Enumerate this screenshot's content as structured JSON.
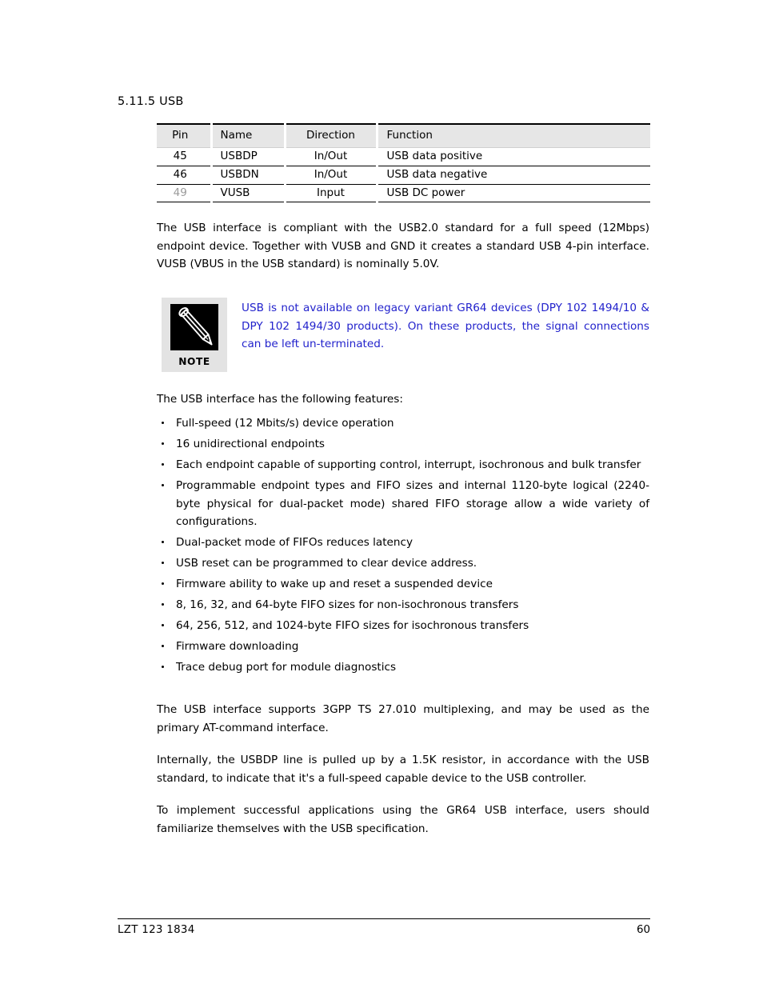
{
  "heading": "5.11.5 USB",
  "table": {
    "columns": [
      "Pin",
      "Name",
      "Direction",
      "Function"
    ],
    "rows": [
      {
        "pin": "45",
        "name": "USBDP",
        "direction": "In/Out",
        "function": "USB data positive",
        "pin_muted": false
      },
      {
        "pin": "46",
        "name": "USBDN",
        "direction": "In/Out",
        "function": "USB data negative",
        "pin_muted": false
      },
      {
        "pin": "49",
        "name": "VUSB",
        "direction": "Input",
        "function": "USB DC power",
        "pin_muted": true
      }
    ]
  },
  "intro_paragraph": "The USB interface is compliant with the USB2.0 standard for a full speed (12Mbps) endpoint device.  Together with VUSB and GND it creates a standard USB 4-pin interface.  VUSB (VBUS in the USB standard) is nominally 5.0V.",
  "note": {
    "badge_label": "NOTE",
    "icon": "pencil-icon",
    "text": "USB is not available on legacy variant GR64 devices (DPY 102 1494/10 & DPY 102 1494/30 products).  On these products, the signal connections can be left un-terminated.",
    "text_color": "#2222cc"
  },
  "features_intro": "The USB interface has the following features:",
  "features": [
    "Full-speed (12 Mbits/s) device operation",
    "16 unidirectional endpoints",
    "Each endpoint capable of supporting control, interrupt, isochronous and bulk transfer",
    "Programmable endpoint types and FIFO sizes and internal 1120-byte logical (2240-byte physical for dual-packet mode) shared FIFO storage allow a wide variety of configurations.",
    "Dual-packet mode of FIFOs reduces latency",
    "USB reset can be programmed to clear device address.",
    "Firmware ability to wake up and reset a suspended device",
    "8, 16, 32, and 64-byte FIFO sizes for non-isochronous transfers",
    "64, 256, 512, and 1024-byte FIFO sizes for isochronous transfers",
    "Firmware downloading",
    "Trace debug port for module diagnostics"
  ],
  "paragraph_3gpp": "The USB interface supports 3GPP TS 27.010 multiplexing, and may be used as the primary AT-command interface.",
  "paragraph_internal": "Internally, the USBDP line is pulled up by a 1.5K resistor, in accordance with the USB standard, to indicate that it's a full-speed capable device to the USB controller.",
  "paragraph_implement": "To implement successful applications using the GR64 USB interface, users should familiarize themselves with the USB specification.",
  "footer": {
    "document_id": "LZT 123 1834",
    "page_number": "60"
  }
}
